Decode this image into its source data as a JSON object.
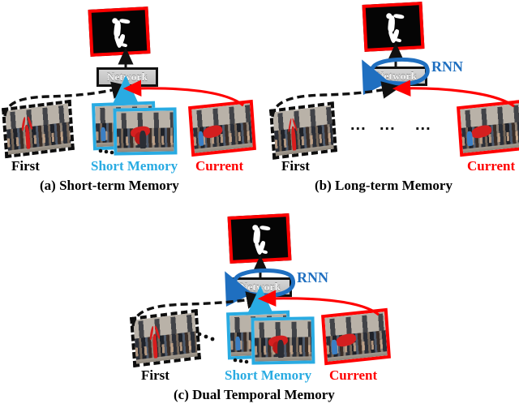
{
  "figure": {
    "kind": "three-panel-diagram",
    "panels": [
      {
        "id": "a",
        "caption": "(a) Short-term Memory",
        "network_label": "Network",
        "labels": {
          "first": "First",
          "short": "Short Memory",
          "current": "Current"
        },
        "has_rnn": false,
        "rnn_label": "",
        "ellipsis_groups": [],
        "frames": [
          "first-frame",
          "short-memory-frame-back",
          "short-memory-frame-front",
          "current-frame",
          "output-mask-frame"
        ]
      },
      {
        "id": "b",
        "caption": "(b) Long-term Memory",
        "network_label": "Network",
        "labels": {
          "first": "First",
          "short": "",
          "current": "Current"
        },
        "has_rnn": true,
        "rnn_label": "RNN",
        "ellipsis_groups": [
          "...",
          "...",
          "..."
        ],
        "frames": [
          "first-frame",
          "current-frame",
          "output-mask-frame"
        ]
      },
      {
        "id": "c",
        "caption": "(c) Dual Temporal Memory",
        "network_label": "Network",
        "labels": {
          "first": "First",
          "short": "Short Memory",
          "current": "Current"
        },
        "has_rnn": true,
        "rnn_label": "RNN",
        "ellipsis_groups": [
          "..."
        ],
        "frames": [
          "first-frame",
          "short-memory-frame-back",
          "short-memory-frame-front",
          "current-frame",
          "output-mask-frame"
        ]
      }
    ]
  },
  "colors": {
    "first_border": "#0D0D0D",
    "short_memory": "#29ABE2",
    "current": "#FF0000",
    "rnn_blue": "#1F6FC0",
    "network_fill": "#C8C8C8",
    "network_border": "#111111",
    "output_background": "#050505",
    "mask_fill": "#FFFFFF"
  },
  "arrows": {
    "first_to_network": "black-dashed-curve",
    "short_to_network": "cyan-straight-arrow",
    "current_to_network": "red-curve-arrow",
    "network_to_output": "black-straight-arrow",
    "rnn_self_loop": "blue-ellipse-loop"
  }
}
